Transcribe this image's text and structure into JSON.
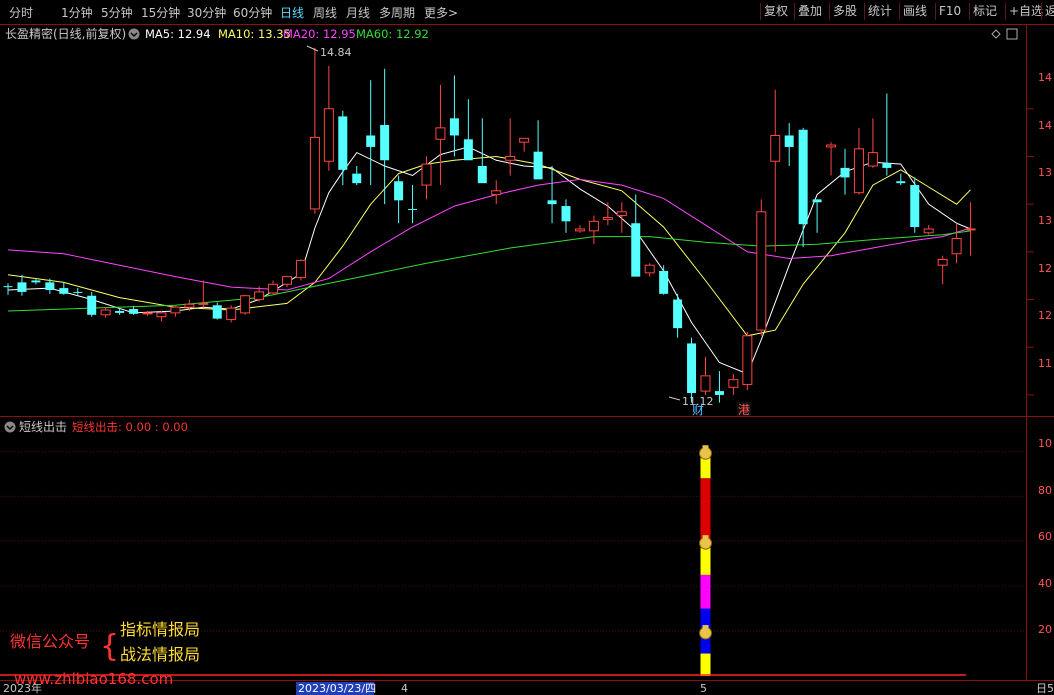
{
  "toolbar": {
    "periods": [
      "分时",
      "1分钟",
      "5分钟",
      "15分钟",
      "30分钟",
      "60分钟",
      "日线",
      "周线",
      "月线",
      "多周期",
      "更多>"
    ],
    "active_period": "日线",
    "right_buttons": [
      "复权",
      "叠加",
      "多股",
      "统计",
      "画线",
      "F10",
      "标记",
      "+自选",
      "返"
    ]
  },
  "main_panel": {
    "stock_title": "长盈精密(日线,前复权)",
    "ma": [
      {
        "label": "MA5: 12.94",
        "color": "#ffffff"
      },
      {
        "label": "MA10: 13.35",
        "color": "#ffff66"
      },
      {
        "label": "MA20: 12.95",
        "color": "#ff44ff"
      },
      {
        "label": "MA60: 12.92",
        "color": "#33dd33"
      }
    ],
    "high_label": "14.84",
    "low_label": "11.12",
    "badge_cai": "财",
    "badge_gang": "港",
    "price_axis": [
      "14",
      "14",
      "13",
      "13",
      "12",
      "12",
      "11"
    ]
  },
  "sub_panel": {
    "title": "短线出击",
    "values": "短线出击: 0.00 : 0.00",
    "axis": [
      "10",
      "80",
      "60",
      "40",
      "20"
    ]
  },
  "watermark": {
    "wechat": "微信公众号",
    "brace": "{",
    "line1": "指标情报局",
    "line2": "战法情报局",
    "site": "www.zhibiao168.com"
  },
  "date_axis": {
    "year": "2023年",
    "cursor_date": "2023/03/23/四",
    "month4": "4",
    "month5": "5",
    "right_label": "日5"
  },
  "colors": {
    "up": "#ff4444",
    "down": "#55ffff",
    "grid": "#8b1010",
    "accent": "#5ad8ff"
  },
  "chart_data": {
    "type": "candlestick",
    "candles": [
      [
        12.34,
        12.37,
        12.25,
        12.33
      ],
      [
        12.38,
        12.46,
        12.24,
        12.28
      ],
      [
        12.4,
        12.42,
        12.36,
        12.38
      ],
      [
        12.38,
        12.42,
        12.26,
        12.3
      ],
      [
        12.32,
        12.38,
        12.25,
        12.26
      ],
      [
        12.28,
        12.32,
        12.25,
        12.27
      ],
      [
        12.24,
        12.28,
        12.02,
        12.04
      ],
      [
        12.04,
        12.12,
        12.01,
        12.09
      ],
      [
        12.08,
        12.11,
        12.04,
        12.06
      ],
      [
        12.1,
        12.13,
        12.04,
        12.05
      ],
      [
        12.05,
        12.08,
        12.03,
        12.06
      ],
      [
        12.02,
        12.08,
        11.97,
        12.06
      ],
      [
        12.06,
        12.13,
        12.02,
        12.12
      ],
      [
        12.12,
        12.2,
        12.08,
        12.15
      ],
      [
        12.16,
        12.4,
        12.12,
        12.16
      ],
      [
        12.14,
        12.17,
        11.99,
        12.0
      ],
      [
        11.99,
        12.14,
        11.96,
        12.11
      ],
      [
        12.06,
        12.25,
        12.04,
        12.24
      ],
      [
        12.2,
        12.34,
        12.18,
        12.28
      ],
      [
        12.27,
        12.4,
        12.26,
        12.36
      ],
      [
        12.36,
        12.45,
        12.33,
        12.44
      ],
      [
        12.43,
        12.62,
        12.4,
        12.61
      ],
      [
        13.15,
        14.84,
        13.1,
        13.9
      ],
      [
        13.65,
        14.65,
        13.55,
        14.2
      ],
      [
        14.12,
        14.18,
        13.4,
        13.56
      ],
      [
        13.52,
        13.6,
        13.4,
        13.42
      ],
      [
        13.92,
        14.5,
        13.4,
        13.8
      ],
      [
        14.03,
        14.62,
        13.2,
        13.66
      ],
      [
        13.44,
        13.5,
        13.0,
        13.24
      ],
      [
        13.15,
        13.4,
        13.0,
        13.14
      ],
      [
        13.4,
        13.7,
        13.25,
        13.62
      ],
      [
        13.88,
        14.45,
        13.4,
        14.0
      ],
      [
        14.1,
        14.55,
        13.7,
        13.92
      ],
      [
        13.88,
        14.3,
        13.8,
        13.66
      ],
      [
        13.6,
        14.1,
        13.5,
        13.42
      ],
      [
        13.3,
        13.45,
        13.2,
        13.34
      ],
      [
        13.66,
        14.1,
        13.5,
        13.7
      ],
      [
        13.85,
        13.89,
        13.75,
        13.89
      ],
      [
        13.75,
        14.08,
        13.6,
        13.46
      ],
      [
        13.24,
        13.6,
        13.0,
        13.2
      ],
      [
        13.18,
        13.25,
        12.9,
        13.02
      ],
      [
        12.92,
        12.98,
        12.9,
        12.94
      ],
      [
        12.92,
        13.08,
        12.78,
        13.02
      ],
      [
        13.04,
        13.22,
        12.98,
        13.06
      ],
      [
        13.08,
        13.22,
        12.9,
        13.12
      ],
      [
        13.0,
        13.3,
        12.98,
        12.44
      ],
      [
        12.48,
        12.58,
        12.44,
        12.56
      ],
      [
        12.5,
        12.56,
        12.25,
        12.26
      ],
      [
        12.2,
        12.26,
        11.8,
        11.9
      ],
      [
        11.74,
        11.8,
        11.12,
        11.22
      ],
      [
        11.24,
        11.6,
        11.2,
        11.4
      ],
      [
        11.24,
        11.45,
        11.12,
        11.2
      ],
      [
        11.28,
        11.42,
        11.2,
        11.36
      ],
      [
        11.31,
        11.86,
        11.25,
        11.82
      ],
      [
        11.88,
        13.25,
        11.82,
        13.12
      ],
      [
        13.65,
        14.4,
        12.7,
        13.92
      ],
      [
        13.92,
        14.05,
        13.6,
        13.8
      ],
      [
        13.98,
        14.0,
        12.75,
        12.99
      ],
      [
        13.25,
        13.25,
        12.9,
        13.22
      ],
      [
        13.8,
        13.85,
        13.5,
        13.82
      ],
      [
        13.58,
        13.78,
        13.3,
        13.48
      ],
      [
        13.32,
        14.0,
        13.3,
        13.78
      ],
      [
        13.6,
        14.1,
        13.58,
        13.74
      ],
      [
        13.63,
        14.36,
        13.5,
        13.58
      ],
      [
        13.44,
        13.52,
        13.4,
        13.42
      ],
      [
        13.4,
        13.48,
        12.9,
        12.96
      ],
      [
        12.9,
        12.98,
        12.88,
        12.94
      ],
      [
        12.56,
        12.66,
        12.36,
        12.62
      ],
      [
        12.68,
        13.0,
        12.58,
        12.84
      ],
      [
        12.94,
        13.22,
        12.66,
        12.94
      ]
    ],
    "ma_lines": [
      {
        "name": "MA5",
        "color": "#ffffff",
        "points": [
          [
            0,
            12.3
          ],
          [
            3,
            12.32
          ],
          [
            6,
            12.2
          ],
          [
            9,
            12.06
          ],
          [
            12,
            12.08
          ],
          [
            14,
            12.12
          ],
          [
            16,
            12.1
          ],
          [
            18,
            12.2
          ],
          [
            20,
            12.38
          ],
          [
            21,
            12.47
          ],
          [
            22,
            12.95
          ],
          [
            23,
            13.32
          ],
          [
            24,
            13.54
          ],
          [
            25,
            13.74
          ],
          [
            27,
            13.6
          ],
          [
            29,
            13.5
          ],
          [
            31,
            13.72
          ],
          [
            33,
            13.8
          ],
          [
            35,
            13.66
          ],
          [
            37,
            13.6
          ],
          [
            39,
            13.58
          ],
          [
            41,
            13.36
          ],
          [
            43,
            13.18
          ],
          [
            45,
            12.92
          ],
          [
            47,
            12.5
          ],
          [
            49,
            11.96
          ],
          [
            51,
            11.54
          ],
          [
            53,
            11.42
          ],
          [
            54,
            11.78
          ],
          [
            56,
            12.56
          ],
          [
            58,
            13.3
          ],
          [
            60,
            13.54
          ],
          [
            62,
            13.64
          ],
          [
            64,
            13.62
          ],
          [
            66,
            13.2
          ],
          [
            68,
            13.0
          ],
          [
            69,
            12.94
          ]
        ]
      },
      {
        "name": "MA10",
        "color": "#ffff66",
        "points": [
          [
            0,
            12.46
          ],
          [
            4,
            12.38
          ],
          [
            8,
            12.22
          ],
          [
            12,
            12.12
          ],
          [
            16,
            12.09
          ],
          [
            20,
            12.16
          ],
          [
            22,
            12.38
          ],
          [
            24,
            12.76
          ],
          [
            26,
            13.2
          ],
          [
            28,
            13.52
          ],
          [
            30,
            13.62
          ],
          [
            32,
            13.66
          ],
          [
            35,
            13.7
          ],
          [
            38,
            13.62
          ],
          [
            41,
            13.46
          ],
          [
            44,
            13.34
          ],
          [
            47,
            12.96
          ],
          [
            50,
            12.4
          ],
          [
            53,
            11.82
          ],
          [
            55,
            11.88
          ],
          [
            57,
            12.36
          ],
          [
            60,
            12.9
          ],
          [
            62,
            13.4
          ],
          [
            64,
            13.56
          ],
          [
            66,
            13.38
          ],
          [
            68,
            13.2
          ],
          [
            69,
            13.35
          ]
        ]
      },
      {
        "name": "MA20",
        "color": "#ff44ff",
        "points": [
          [
            0,
            12.72
          ],
          [
            4,
            12.68
          ],
          [
            8,
            12.56
          ],
          [
            12,
            12.44
          ],
          [
            16,
            12.33
          ],
          [
            20,
            12.3
          ],
          [
            23,
            12.42
          ],
          [
            26,
            12.7
          ],
          [
            29,
            12.96
          ],
          [
            32,
            13.18
          ],
          [
            35,
            13.3
          ],
          [
            38,
            13.4
          ],
          [
            41,
            13.46
          ],
          [
            44,
            13.4
          ],
          [
            47,
            13.26
          ],
          [
            50,
            12.98
          ],
          [
            53,
            12.7
          ],
          [
            56,
            12.63
          ],
          [
            59,
            12.66
          ],
          [
            62,
            12.74
          ],
          [
            65,
            12.82
          ],
          [
            67,
            12.86
          ],
          [
            69,
            12.95
          ]
        ]
      },
      {
        "name": "MA60",
        "color": "#33dd33",
        "points": [
          [
            0,
            12.08
          ],
          [
            6,
            12.11
          ],
          [
            12,
            12.14
          ],
          [
            18,
            12.22
          ],
          [
            24,
            12.4
          ],
          [
            30,
            12.58
          ],
          [
            36,
            12.74
          ],
          [
            42,
            12.86
          ],
          [
            46,
            12.86
          ],
          [
            50,
            12.8
          ],
          [
            54,
            12.76
          ],
          [
            58,
            12.78
          ],
          [
            63,
            12.84
          ],
          [
            67,
            12.88
          ],
          [
            69,
            12.92
          ]
        ]
      }
    ],
    "indicator": {
      "title": "短线出击",
      "index": 50,
      "segments": [
        {
          "from": 0,
          "to": 10,
          "color": "#ffff00"
        },
        {
          "from": 10,
          "to": 30,
          "color": "#0000ee"
        },
        {
          "from": 30,
          "to": 45,
          "color": "#ff00ff"
        },
        {
          "from": 45,
          "to": 58,
          "color": "#ffff00"
        },
        {
          "from": 58,
          "to": 88,
          "color": "#dd0000"
        },
        {
          "from": 88,
          "to": 100,
          "color": "#ffff00"
        }
      ],
      "coin_levels": [
        20,
        60,
        100
      ],
      "ylim": [
        0,
        105
      ]
    },
    "ylim": [
      11.0,
      14.9
    ]
  }
}
